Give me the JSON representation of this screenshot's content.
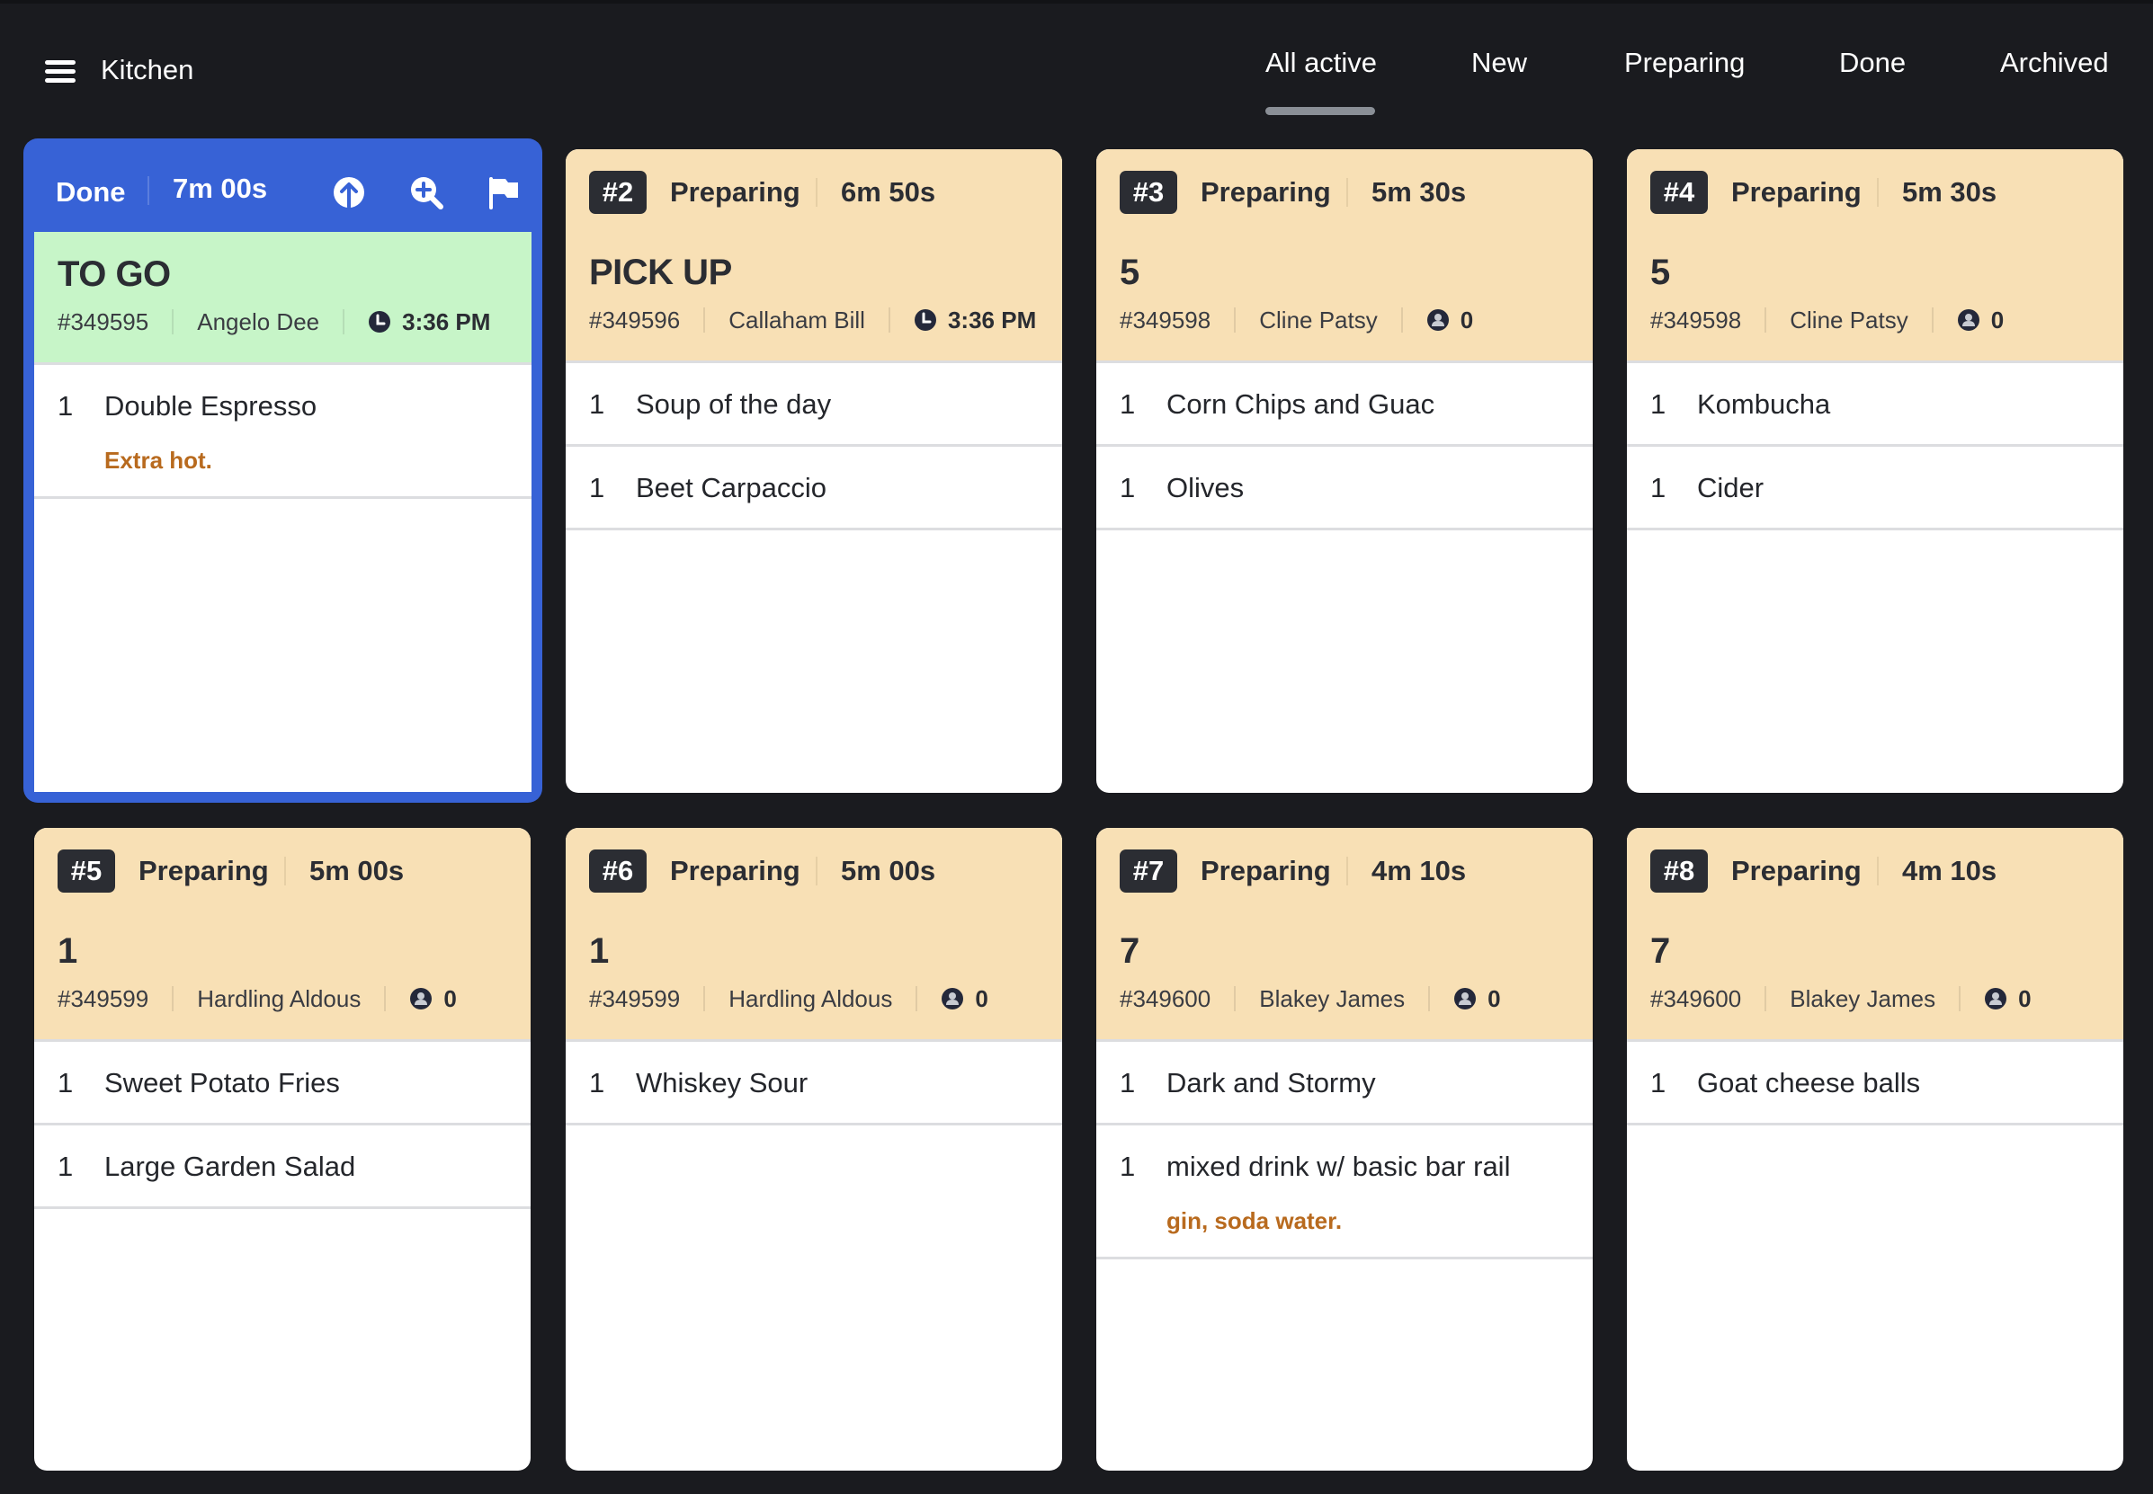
{
  "header": {
    "menu_icon": "hamburger-menu-icon",
    "title": "Kitchen",
    "tabs": [
      {
        "label": "All active",
        "active": true
      },
      {
        "label": "New",
        "active": false
      },
      {
        "label": "Preparing",
        "active": false
      },
      {
        "label": "Done",
        "active": false
      },
      {
        "label": "Archived",
        "active": false
      }
    ]
  },
  "colors": {
    "background": "#1a1b1f",
    "done_accent": "#3762d6",
    "done_info_bg": "#c7f5c8",
    "preparing_bg": "#f8e0b5",
    "note_text": "#b86a1e",
    "badge_bg": "#2b2d33",
    "tab_indicator": "#8a8f96"
  },
  "tickets": [
    {
      "badge": "",
      "status": "Done",
      "elapsed": "7m 00s",
      "actions": [
        "arrow-up-circle-icon",
        "zoom-in-icon",
        "flag-icon"
      ],
      "title": "TO GO",
      "order_no": "#349595",
      "customer": "Angelo Dee",
      "meta_icon": "clock-icon",
      "meta_value": "3:36 PM",
      "items": [
        {
          "qty": "1",
          "name": "Double Espresso",
          "note": "Extra hot."
        }
      ]
    },
    {
      "badge": "#2",
      "status": "Preparing",
      "elapsed": "6m 50s",
      "title": "PICK UP",
      "order_no": "#349596",
      "customer": "Callaham Bill",
      "meta_icon": "clock-icon",
      "meta_value": "3:36 PM",
      "items": [
        {
          "qty": "1",
          "name": "Soup of the day",
          "note": ""
        },
        {
          "qty": "1",
          "name": "Beet Carpaccio",
          "note": ""
        }
      ]
    },
    {
      "badge": "#3",
      "status": "Preparing",
      "elapsed": "5m 30s",
      "title": "5",
      "order_no": "#349598",
      "customer": "Cline Patsy",
      "meta_icon": "guest-icon",
      "meta_value": "0",
      "items": [
        {
          "qty": "1",
          "name": "Corn Chips and Guac",
          "note": ""
        },
        {
          "qty": "1",
          "name": "Olives",
          "note": ""
        }
      ]
    },
    {
      "badge": "#4",
      "status": "Preparing",
      "elapsed": "5m 30s",
      "title": "5",
      "order_no": "#349598",
      "customer": "Cline Patsy",
      "meta_icon": "guest-icon",
      "meta_value": "0",
      "items": [
        {
          "qty": "1",
          "name": "Kombucha",
          "note": ""
        },
        {
          "qty": "1",
          "name": "Cider",
          "note": ""
        }
      ]
    },
    {
      "badge": "#5",
      "status": "Preparing",
      "elapsed": "5m 00s",
      "title": "1",
      "order_no": "#349599",
      "customer": "Hardling Aldous",
      "meta_icon": "guest-icon",
      "meta_value": "0",
      "items": [
        {
          "qty": "1",
          "name": "Sweet Potato Fries",
          "note": ""
        },
        {
          "qty": "1",
          "name": "Large Garden Salad",
          "note": ""
        }
      ]
    },
    {
      "badge": "#6",
      "status": "Preparing",
      "elapsed": "5m 00s",
      "title": "1",
      "order_no": "#349599",
      "customer": "Hardling Aldous",
      "meta_icon": "guest-icon",
      "meta_value": "0",
      "items": [
        {
          "qty": "1",
          "name": "Whiskey Sour",
          "note": ""
        }
      ]
    },
    {
      "badge": "#7",
      "status": "Preparing",
      "elapsed": "4m 10s",
      "title": "7",
      "order_no": "#349600",
      "customer": "Blakey James",
      "meta_icon": "guest-icon",
      "meta_value": "0",
      "items": [
        {
          "qty": "1",
          "name": "Dark and Stormy",
          "note": ""
        },
        {
          "qty": "1",
          "name": "mixed drink w/ basic bar rail",
          "note": "gin, soda water."
        }
      ]
    },
    {
      "badge": "#8",
      "status": "Preparing",
      "elapsed": "4m 10s",
      "title": "7",
      "order_no": "#349600",
      "customer": "Blakey James",
      "meta_icon": "guest-icon",
      "meta_value": "0",
      "items": [
        {
          "qty": "1",
          "name": "Goat cheese balls",
          "note": ""
        }
      ]
    }
  ]
}
